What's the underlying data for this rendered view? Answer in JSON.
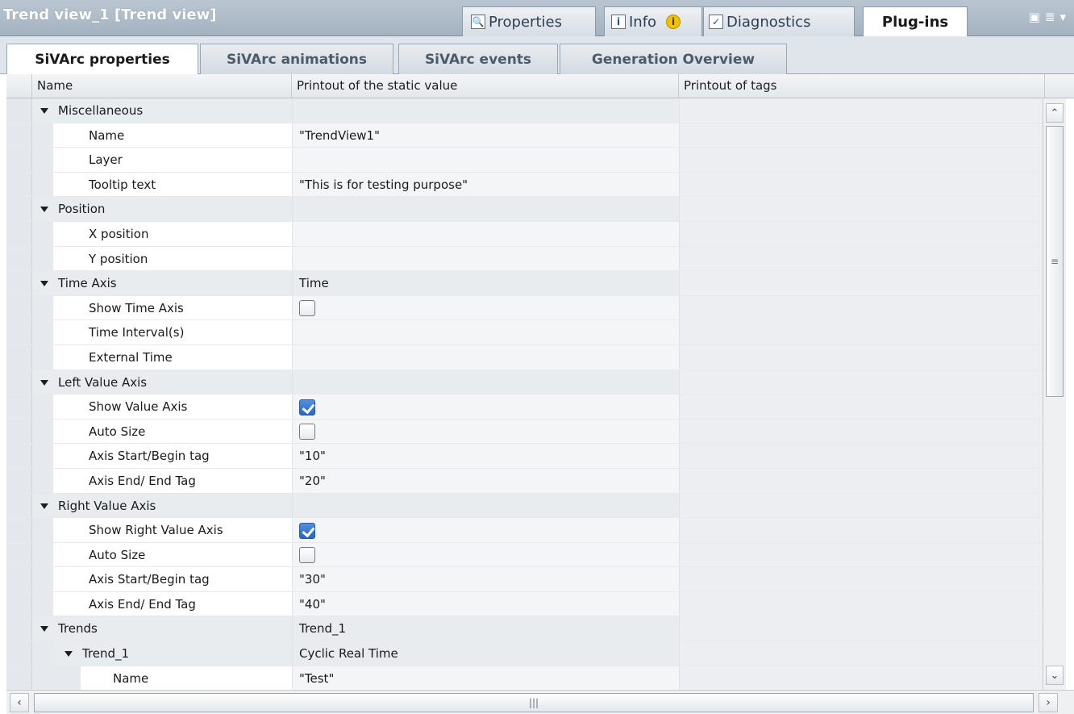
{
  "window": {
    "title": "Trend view_1 [Trend view]",
    "tabs": [
      {
        "label": "Properties",
        "icon": "properties-icon"
      },
      {
        "label": "Info",
        "icon": "info-icon"
      },
      {
        "label": "Diagnostics",
        "icon": "diagnostics-icon"
      },
      {
        "label": "Plug-ins",
        "active": true
      }
    ],
    "info_badge": "i",
    "accent_color": "#2a66c0"
  },
  "subtabs": [
    {
      "label": "SiVArc properties",
      "active": true
    },
    {
      "label": "SiVArc animations"
    },
    {
      "label": "SiVArc events"
    },
    {
      "label": "Generation Overview"
    }
  ],
  "columns": [
    "Name",
    "Printout of the static value",
    "Printout of tags"
  ],
  "rows": [
    {
      "level": 0,
      "group": true,
      "name": "Miscellaneous",
      "value": ""
    },
    {
      "level": 1,
      "name": "Name",
      "value": "\"TrendView1\""
    },
    {
      "level": 1,
      "name": "Layer",
      "value": ""
    },
    {
      "level": 1,
      "name": "Tooltip text",
      "value": "\"This is for testing purpose\""
    },
    {
      "level": 0,
      "group": true,
      "name": "Position",
      "value": ""
    },
    {
      "level": 1,
      "name": "X position",
      "value": ""
    },
    {
      "level": 1,
      "name": "Y position",
      "value": ""
    },
    {
      "level": 0,
      "group": true,
      "name": "Time Axis",
      "value": "Time"
    },
    {
      "level": 1,
      "name": "Show Time Axis",
      "checkbox": false
    },
    {
      "level": 1,
      "name": "Time Interval(s)",
      "value": ""
    },
    {
      "level": 1,
      "name": "External Time",
      "value": ""
    },
    {
      "level": 0,
      "group": true,
      "name": "Left Value Axis",
      "value": ""
    },
    {
      "level": 1,
      "name": "Show Value Axis",
      "checkbox": true
    },
    {
      "level": 1,
      "name": "Auto Size",
      "checkbox": false
    },
    {
      "level": 1,
      "name": "Axis Start/Begin tag",
      "value": "\"10\""
    },
    {
      "level": 1,
      "name": "Axis End/ End Tag",
      "value": "\"20\""
    },
    {
      "level": 0,
      "group": true,
      "name": "Right Value Axis",
      "value": ""
    },
    {
      "level": 1,
      "name": "Show Right Value Axis",
      "checkbox": true
    },
    {
      "level": 1,
      "name": "Auto Size",
      "checkbox": false
    },
    {
      "level": 1,
      "name": "Axis Start/Begin tag",
      "value": "\"30\""
    },
    {
      "level": 1,
      "name": "Axis End/ End Tag",
      "value": "\"40\""
    },
    {
      "level": 0,
      "group": true,
      "name": "Trends",
      "value": "Trend_1"
    },
    {
      "level": 1,
      "group": true,
      "name": "Trend_1",
      "value": "Cyclic Real Time"
    },
    {
      "level": 2,
      "name": "Name",
      "value": "\"Test\""
    }
  ]
}
